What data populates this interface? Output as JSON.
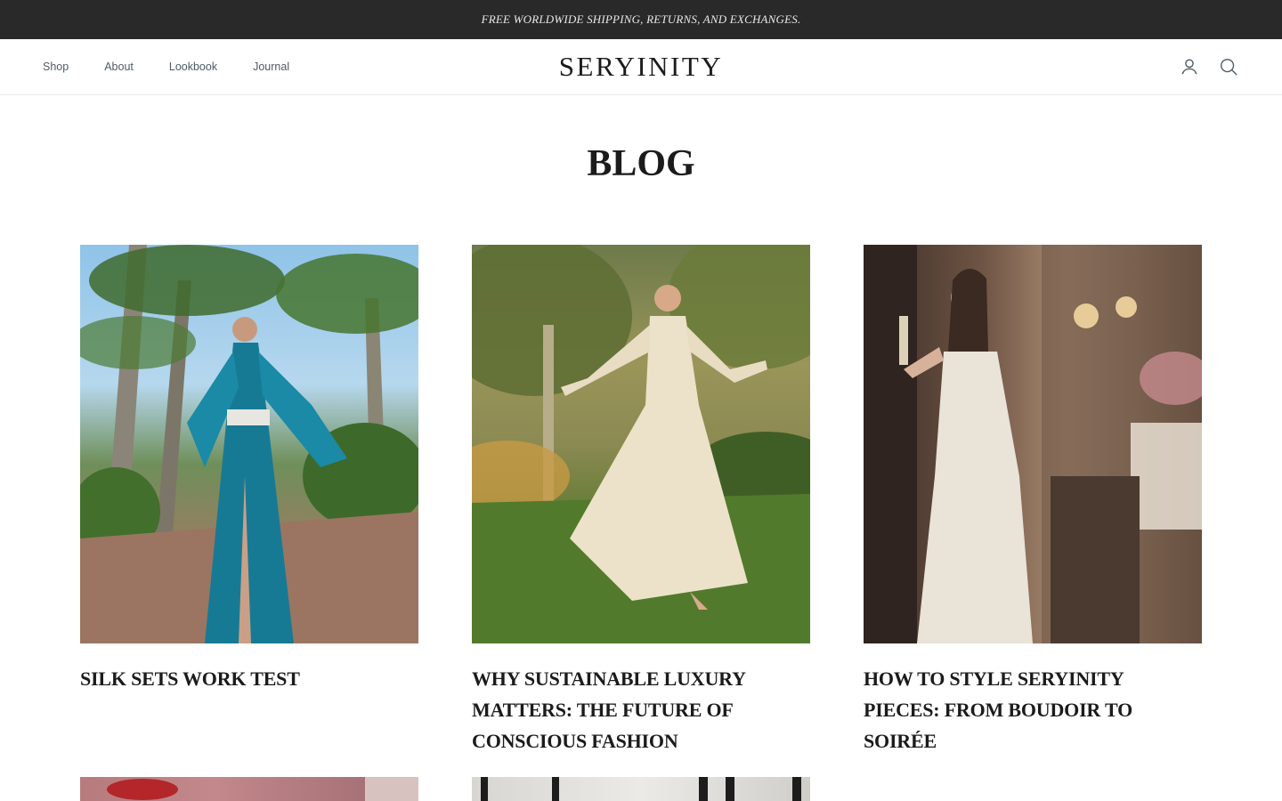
{
  "announcement": {
    "text": "FREE WORLDWIDE SHIPPING, RETURNS, AND EXCHANGES."
  },
  "header": {
    "nav": [
      {
        "label": "Shop"
      },
      {
        "label": "About"
      },
      {
        "label": "Lookbook"
      },
      {
        "label": "Journal"
      }
    ],
    "logo": "SERYINITY",
    "icons": [
      "account-icon",
      "search-icon"
    ]
  },
  "page": {
    "title": "BLOG"
  },
  "posts": [
    {
      "title": "SILK SETS WORK TEST"
    },
    {
      "title": "WHY SUSTAINABLE LUXURY MATTERS: THE FUTURE OF CONSCIOUS FASHION"
    },
    {
      "title": "HOW TO STYLE SERYINITY PIECES: FROM BOUDOIR TO SOIRÉE"
    },
    {
      "title": ""
    },
    {
      "title": ""
    }
  ],
  "colors": {
    "announcement_bg": "#292929",
    "text": "#1c1b1b",
    "nav_text": "#4f5a63"
  }
}
